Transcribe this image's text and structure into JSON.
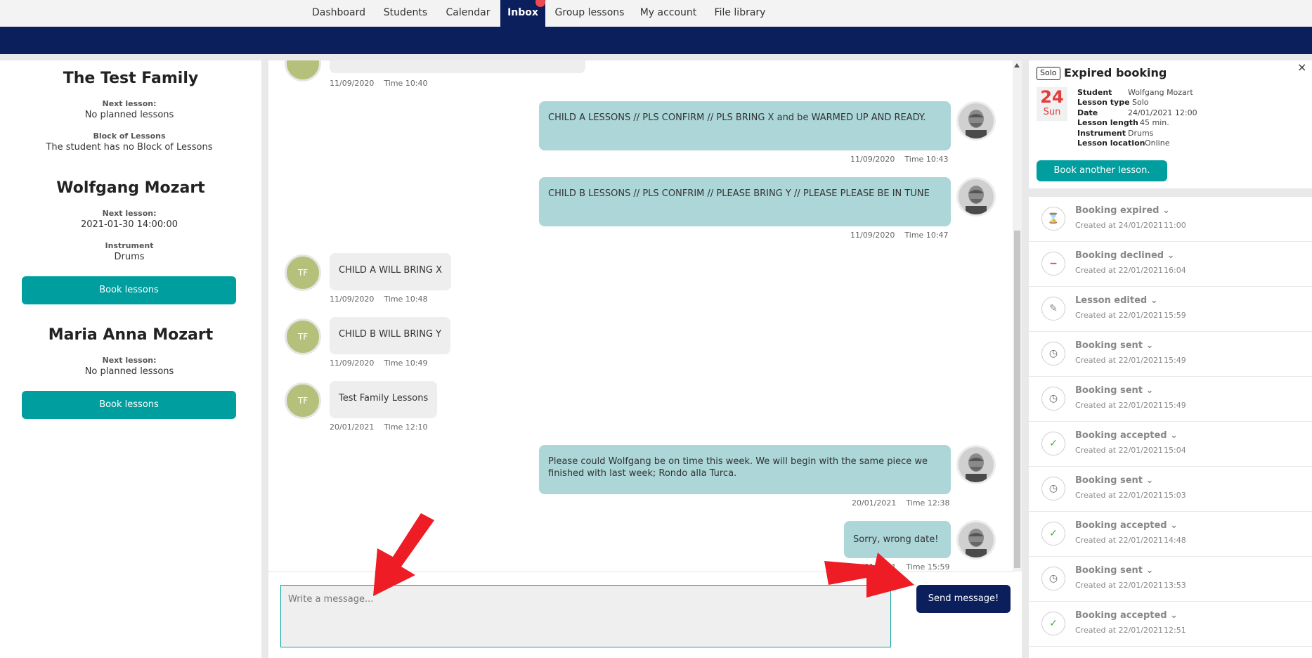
{
  "nav": {
    "items": [
      "Dashboard",
      "Students",
      "Calendar",
      "Inbox",
      "Group lessons",
      "My account",
      "File library"
    ]
  },
  "students": [
    {
      "name": "The Test Family",
      "next_lesson_label": "Next lesson:",
      "next_lesson_value": "No planned lessons",
      "block_label": "Block of Lessons",
      "block_value": "The student has no Block of Lessons"
    },
    {
      "name": "Wolfgang Mozart",
      "next_lesson_label": "Next lesson:",
      "next_lesson_value": "2021-01-30 14:00:00",
      "instrument_label": "Instrument",
      "instrument_value": "Drums",
      "book_button": "Book lessons"
    },
    {
      "name": "Maria Anna Mozart",
      "next_lesson_label": "Next lesson:",
      "next_lesson_value": "No planned lessons",
      "book_button": "Book lessons"
    }
  ],
  "chat": {
    "messages": [
      {
        "from": "them",
        "initials": "",
        "text": "",
        "date": "11/09/2020",
        "time": "Time 10:40"
      },
      {
        "from": "me",
        "text": "CHILD A LESSONS // PLS CONFIRM // PLS BRING X and be WARMED UP AND READY.",
        "date": "11/09/2020",
        "time": "Time 10:43"
      },
      {
        "from": "me",
        "text": "CHILD B LESSONS // PLS CONFRIM // PLEASE BRING Y // PLEASE PLEASE BE IN TUNE",
        "date": "11/09/2020",
        "time": "Time 10:47"
      },
      {
        "from": "them",
        "initials": "TF",
        "text": "CHILD A WILL BRING X",
        "date": "11/09/2020",
        "time": "Time 10:48"
      },
      {
        "from": "them",
        "initials": "TF",
        "text": "CHILD B WILL BRING Y",
        "date": "11/09/2020",
        "time": "Time 10:49"
      },
      {
        "from": "them",
        "initials": "TF",
        "text": "Test Family Lessons",
        "date": "20/01/2021",
        "time": "Time 12:10"
      },
      {
        "from": "me",
        "text": "Please could Wolfgang be on time this week. We will begin with the same piece we finished with last week; Rondo alla Turca.",
        "date": "20/01/2021",
        "time": "Time 12:38"
      },
      {
        "from": "me",
        "text": "Sorry, wrong date!",
        "date": "20/01/2021",
        "time": "Time 15:59"
      }
    ],
    "input_placeholder": "Write a message...",
    "send_button": "Send message!"
  },
  "booking": {
    "badge": "Solo",
    "title": "Expired booking",
    "day_num": "24",
    "day_name": "Sun",
    "close": "×",
    "details": [
      {
        "label": "Student",
        "value": "Wolfgang Mozart"
      },
      {
        "label": "Lesson type",
        "value": "Solo"
      },
      {
        "label": "Date",
        "value": "24/01/2021 12:00"
      },
      {
        "label": "Lesson length",
        "value": "45 min."
      },
      {
        "label": "Instrument",
        "value": "Drums"
      },
      {
        "label": "Lesson location",
        "value": "Online"
      }
    ],
    "book_another": "Book another lesson."
  },
  "history": [
    {
      "title": "Booking expired",
      "created": "Created at 24/01/2021",
      "time": "11:00",
      "icon": "hourglass-icon",
      "color": "#e43b3b"
    },
    {
      "title": "Booking declined",
      "created": "Created at 22/01/2021",
      "time": "16:04",
      "icon": "minus-icon",
      "color": "#e43b3b"
    },
    {
      "title": "Lesson edited",
      "created": "Created at 22/01/2021",
      "time": "15:59",
      "icon": "edit-icon",
      "color": "#888888"
    },
    {
      "title": "Booking sent",
      "created": "Created at 22/01/2021",
      "time": "15:49",
      "icon": "clock-icon",
      "color": "#666666"
    },
    {
      "title": "Booking sent",
      "created": "Created at 22/01/2021",
      "time": "15:49",
      "icon": "clock-icon",
      "color": "#666666"
    },
    {
      "title": "Booking accepted",
      "created": "Created at 22/01/2021",
      "time": "15:04",
      "icon": "check-icon",
      "color": "#3aaa3a"
    },
    {
      "title": "Booking sent",
      "created": "Created at 22/01/2021",
      "time": "15:03",
      "icon": "clock-icon",
      "color": "#666666"
    },
    {
      "title": "Booking accepted",
      "created": "Created at 22/01/2021",
      "time": "14:48",
      "icon": "check-icon",
      "color": "#3aaa3a"
    },
    {
      "title": "Booking sent",
      "created": "Created at 22/01/2021",
      "time": "13:53",
      "icon": "clock-icon",
      "color": "#666666"
    },
    {
      "title": "Booking accepted",
      "created": "Created at 22/01/2021",
      "time": "12:51",
      "icon": "check-icon",
      "color": "#3aaa3a"
    }
  ],
  "colors": {
    "navy": "#0b1f5c",
    "teal": "#009e9e",
    "bubble_out": "#acd6d8",
    "bubble_in": "#eeeeee",
    "avatar_tf": "#b5c07a",
    "alert_red": "#e43b3b",
    "arrow_red": "#ee1c25"
  }
}
